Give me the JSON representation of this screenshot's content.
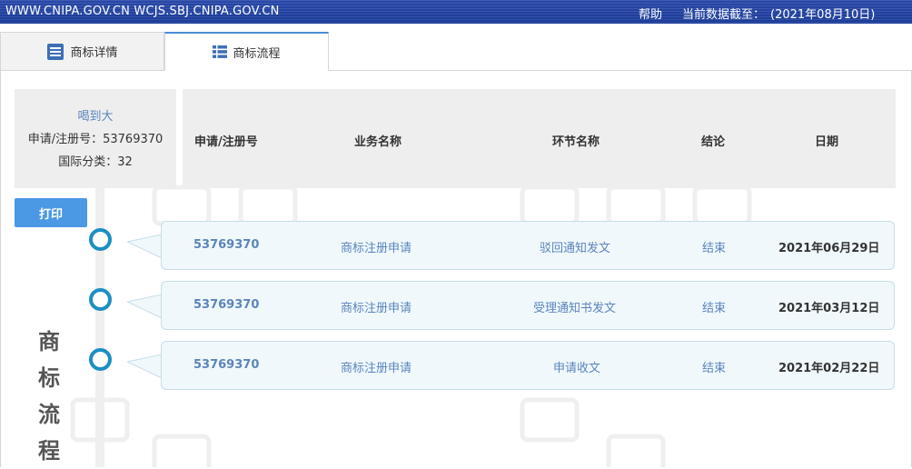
{
  "topbar": {
    "sites": "WWW.CNIPA.GOV.CN WCJS.SBJ.CNIPA.GOV.CN",
    "help": "帮助",
    "update_label": "当前数据截至：",
    "update_date": "(2021年08月10日)"
  },
  "tabs": [
    {
      "label": "商标详情",
      "icon": "document-list-icon",
      "active": false
    },
    {
      "label": "商标流程",
      "icon": "list-icon",
      "active": true
    }
  ],
  "info": {
    "name": "喝到大",
    "reg_no_label": "申请/注册号：",
    "reg_no": "53769370",
    "class_label": "国际分类：",
    "class_value": "32"
  },
  "table": {
    "columns": [
      "申请/注册号",
      "业务名称",
      "环节名称",
      "结论",
      "日期"
    ],
    "rows": [
      {
        "reg_no": "53769370",
        "business": "商标注册申请",
        "step": "驳回通知发文",
        "result": "结束",
        "date": "2021年06月29日"
      },
      {
        "reg_no": "53769370",
        "business": "商标注册申请",
        "step": "受理通知书发文",
        "result": "结束",
        "date": "2021年03月12日"
      },
      {
        "reg_no": "53769370",
        "business": "商标注册申请",
        "step": "申请收文",
        "result": "结束",
        "date": "2021年02月22日"
      }
    ]
  },
  "print_label": "打印",
  "vertical_label": [
    "商",
    "标",
    "流",
    "程"
  ],
  "colors": {
    "accent": "#4b98e4",
    "timeline_dot": "#1b8fc4",
    "link": "#5b84bd",
    "topbar": "#1b3b98"
  }
}
